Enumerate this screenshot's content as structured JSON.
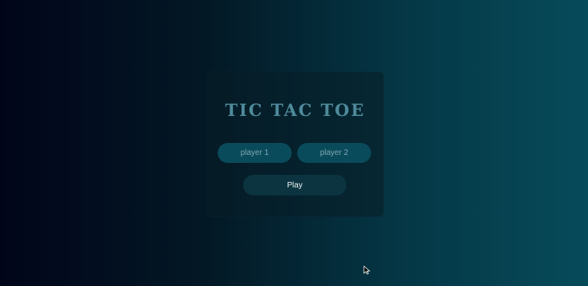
{
  "game": {
    "title": "TIC TAC TOE",
    "player1_placeholder": "player 1",
    "player2_placeholder": "player 2",
    "play_label": "Play"
  },
  "icons": {
    "cursor": "mouse-pointer-icon"
  }
}
